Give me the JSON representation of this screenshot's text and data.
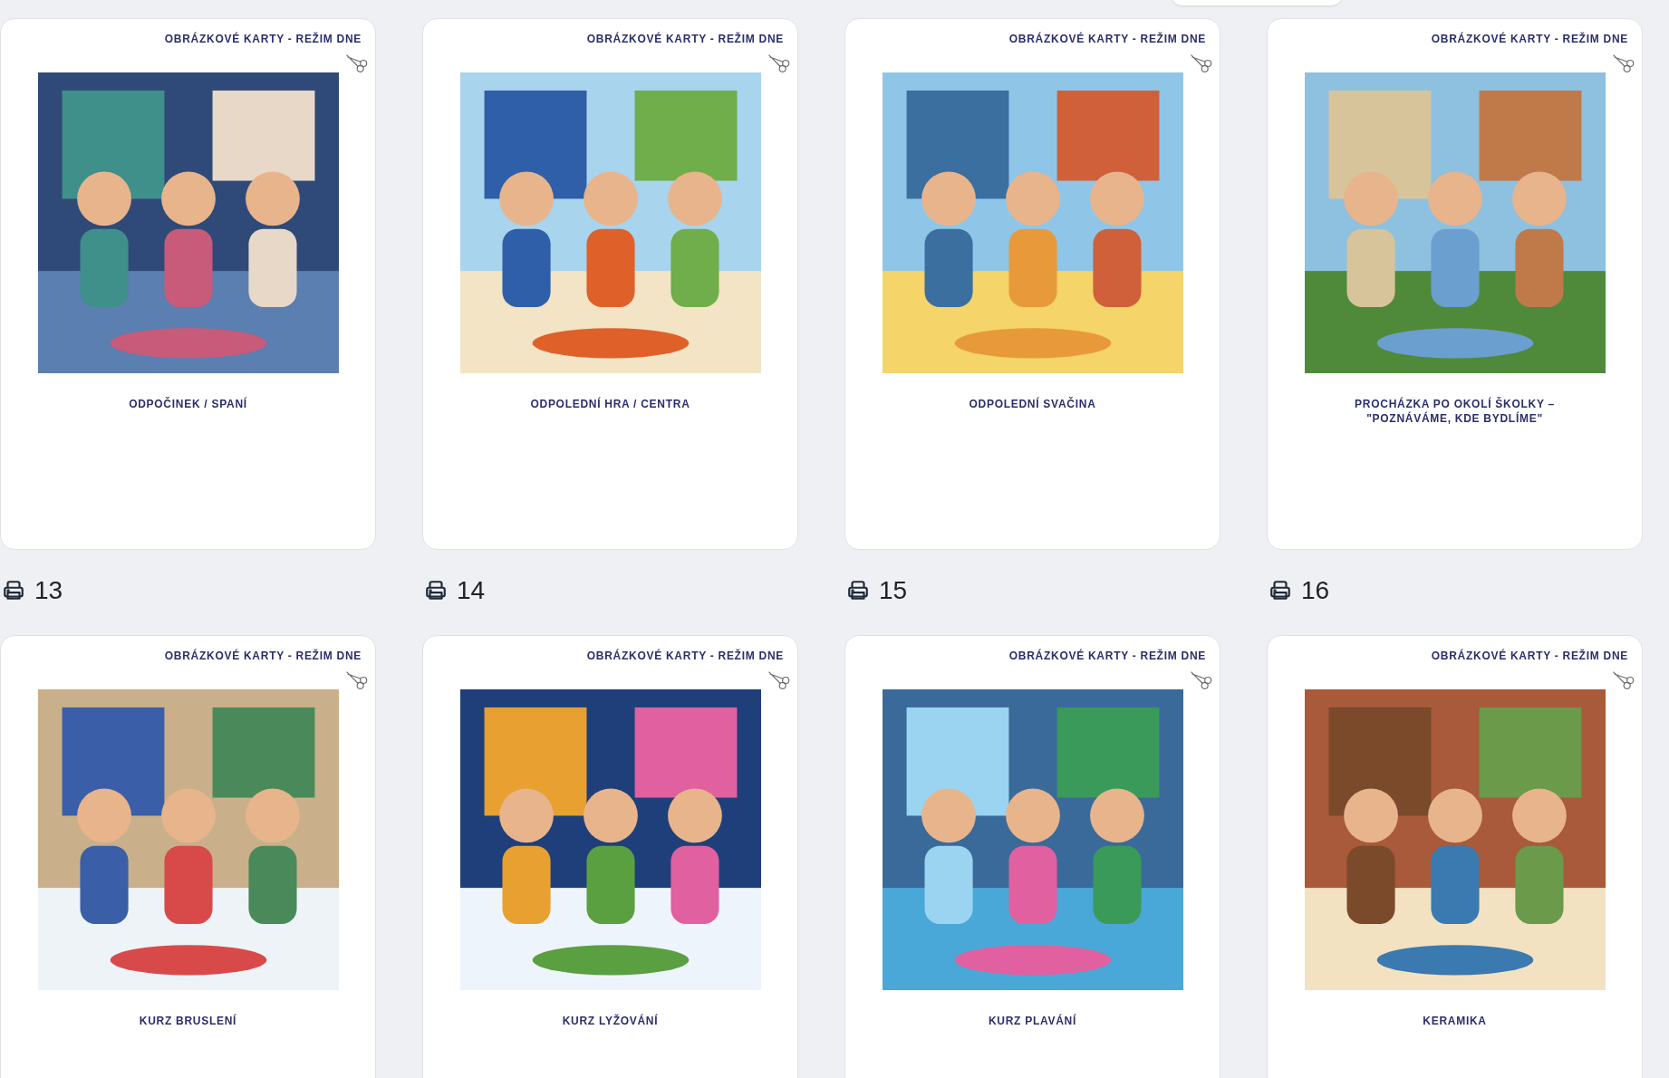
{
  "cards": [
    {
      "header": "OBRÁZKOVÉ KARTY - REŽIM DNE",
      "title": "ODPOČINEK / SPANÍ",
      "print_count": "13"
    },
    {
      "header": "OBRÁZKOVÉ KARTY - REŽIM DNE",
      "title": "ODPOLEDNÍ HRA / CENTRA",
      "print_count": "14"
    },
    {
      "header": "OBRÁZKOVÉ KARTY - REŽIM DNE",
      "title": "ODPOLEDNÍ SVAČINA",
      "print_count": "15"
    },
    {
      "header": "OBRÁZKOVÉ KARTY - REŽIM DNE",
      "title": "PROCHÁZKA PO OKOLÍ ŠKOLKY – \"POZNÁVÁME, KDE BYDLÍME\"",
      "print_count": "16"
    },
    {
      "header": "OBRÁZKOVÉ KARTY - REŽIM DNE",
      "title": "KURZ BRUSLENÍ"
    },
    {
      "header": "OBRÁZKOVÉ KARTY - REŽIM DNE",
      "title": "KURZ LYŽOVÁNÍ"
    },
    {
      "header": "OBRÁZKOVÉ KARTY - REŽIM DNE",
      "title": "KURZ PLAVÁNÍ"
    },
    {
      "header": "OBRÁZKOVÉ KARTY - REŽIM DNE",
      "title": "KERAMIKA"
    }
  ]
}
